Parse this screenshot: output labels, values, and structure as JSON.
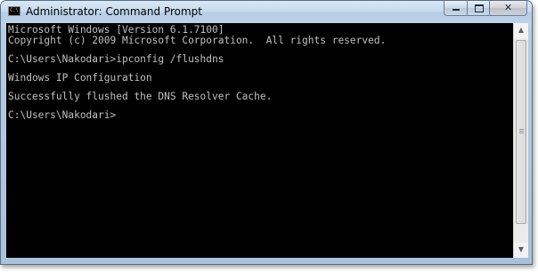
{
  "window": {
    "title": "Administrator: Command Prompt",
    "app_icon": "C:\\",
    "minimize": "minimize-icon",
    "maximize": "maximize-icon",
    "close_glyph": "✕"
  },
  "console": {
    "lines": [
      "Microsoft Windows [Version 6.1.7100]",
      "Copyright (c) 2009 Microsoft Corporation.  All rights reserved.",
      "",
      "C:\\Users\\Nakodari>ipconfig /flushdns",
      "",
      "Windows IP Configuration",
      "",
      "Successfully flushed the DNS Resolver Cache.",
      "",
      "C:\\Users\\Nakodari>"
    ]
  },
  "scrollbar": {
    "up_arrow": "▲",
    "down_arrow": "▼"
  },
  "colors": {
    "console_bg": "#000000",
    "console_text": "#c0c0c0"
  }
}
